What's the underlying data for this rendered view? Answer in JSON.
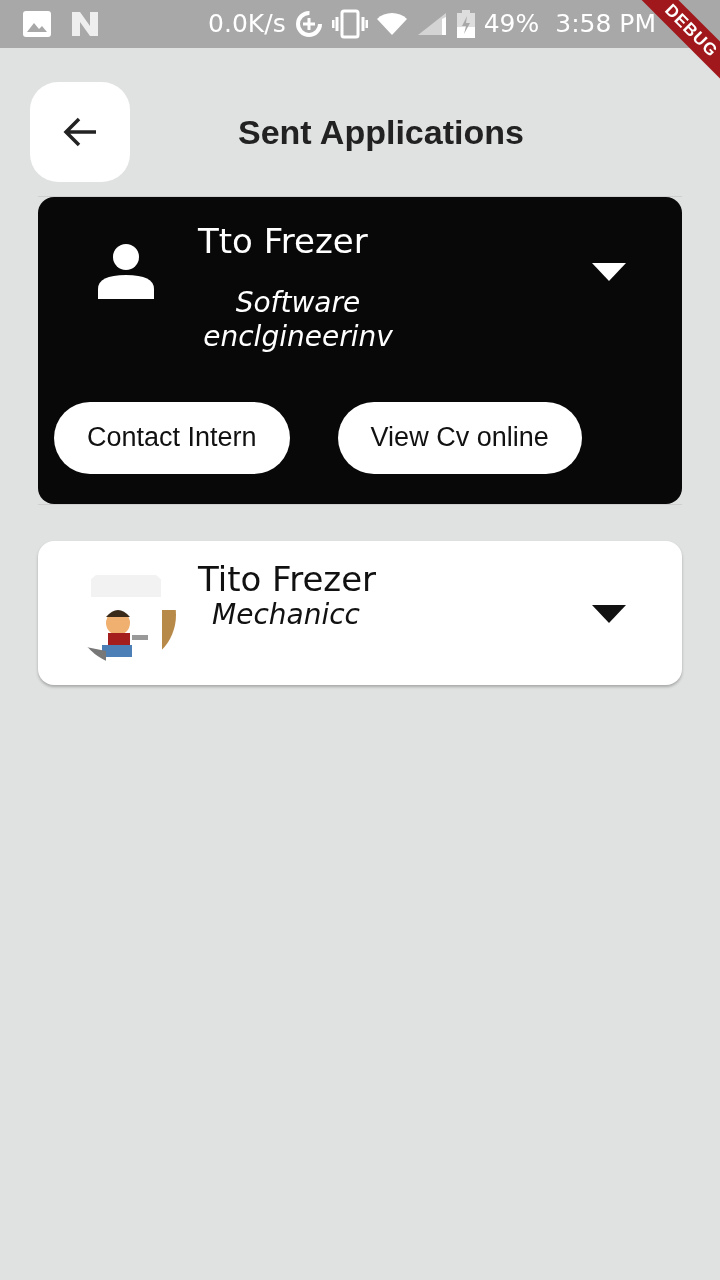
{
  "status_bar": {
    "speed": "0.0K/s",
    "battery": "49%",
    "time": "3:58 PM"
  },
  "debug_banner": "DEBUG",
  "header": {
    "title": "Sent Applications"
  },
  "applications": [
    {
      "name": "Tto Frezer",
      "role": "Software enclgineerinv",
      "avatar": {
        "kind": "icon"
      },
      "expanded": true,
      "buttons": [
        "Contact Intern",
        "View Cv online"
      ]
    },
    {
      "name": "Tito Frezer",
      "role": "Mechanicc",
      "expanded": false
    }
  ]
}
